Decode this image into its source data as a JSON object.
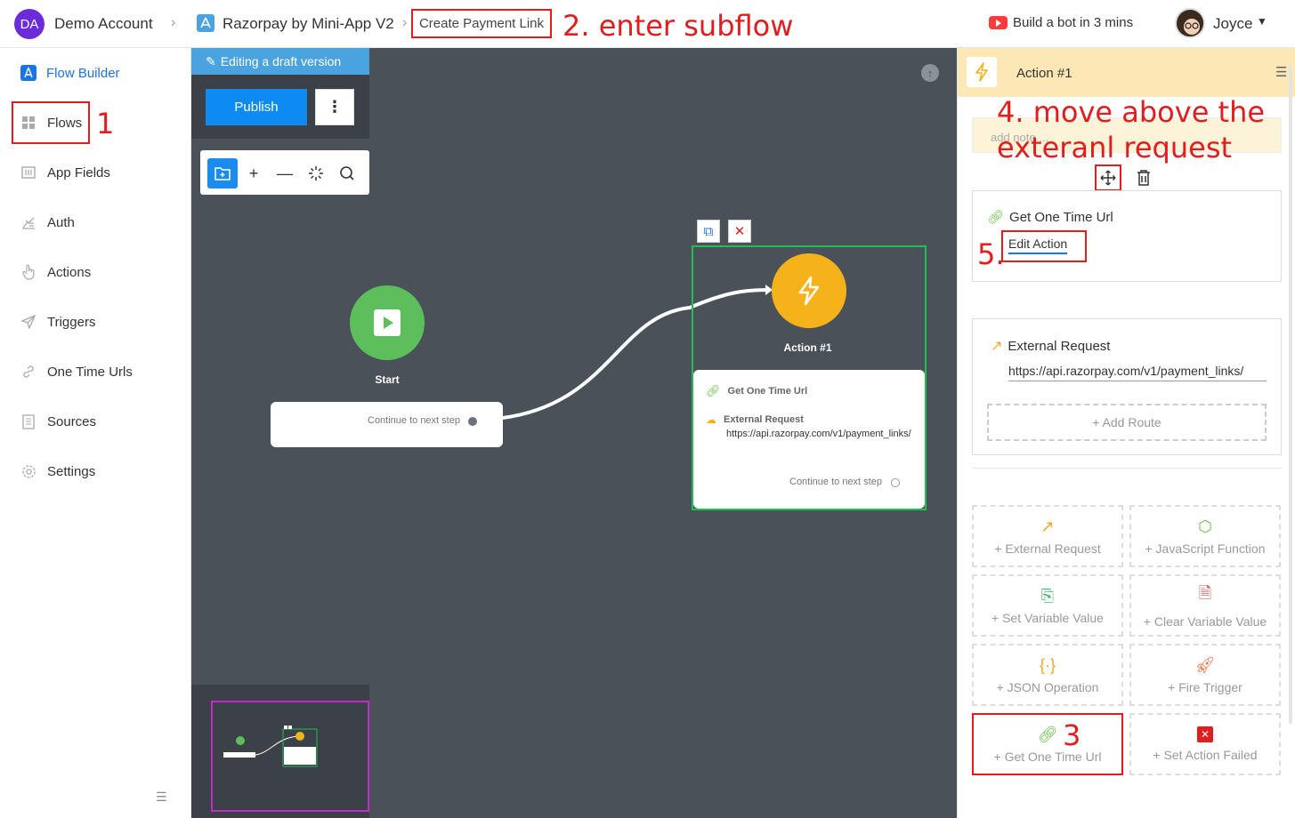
{
  "header": {
    "account_initials": "DA",
    "account_name": "Demo Account",
    "app_name": "Razorpay by Mini-App V2",
    "breadcrumb_current": "Create Payment Link",
    "bot_link": "Build a bot in 3 mins",
    "user_name": "Joyce"
  },
  "sidebar": {
    "items": [
      {
        "label": "Flow Builder",
        "icon": "flow-builder-icon"
      },
      {
        "label": "Flows",
        "icon": "grid-icon"
      },
      {
        "label": "App Fields",
        "icon": "app-fields-icon"
      },
      {
        "label": "Auth",
        "icon": "auth-icon"
      },
      {
        "label": "Actions",
        "icon": "hand-pointer-icon"
      },
      {
        "label": "Triggers",
        "icon": "send-icon"
      },
      {
        "label": "One Time Urls",
        "icon": "link-icon"
      },
      {
        "label": "Sources",
        "icon": "document-icon"
      },
      {
        "label": "Settings",
        "icon": "gear-icon"
      }
    ]
  },
  "canvas": {
    "draft_banner": "Editing a draft version",
    "publish_label": "Publish",
    "start_label": "Start",
    "start_continue": "Continue to next step",
    "action_label": "Action #1",
    "action_step1": "Get One Time Url",
    "action_step2": "External Request",
    "action_step2_url": "https://api.razorpay.com/v1/payment_links/",
    "action_continue": "Continue to next step"
  },
  "panel": {
    "title": "Action #1",
    "note_placeholder": "add note ...",
    "card1_title": "Get One Time Url",
    "card1_edit": "Edit Action",
    "card2_title": "External Request",
    "card2_url": "https://api.razorpay.com/v1/payment_links/",
    "add_route": "+ Add Route",
    "ops": [
      {
        "label": "+ External Request",
        "icon": "external-link-icon",
        "color": "#f5a623"
      },
      {
        "label": "+ JavaScript Function",
        "icon": "nodejs-icon",
        "color": "#6cc24a"
      },
      {
        "label": "+ Set Variable Value",
        "icon": "set-variable-icon",
        "color": "#3fb86b"
      },
      {
        "label": "+ Clear Variable Value",
        "icon": "clear-variable-icon",
        "color": "#e2453c"
      },
      {
        "label": "+ JSON Operation",
        "icon": "json-braces-icon",
        "color": "#f5a623"
      },
      {
        "label": "+ Fire Trigger",
        "icon": "rocket-icon",
        "color": "#f26b3a"
      },
      {
        "label": "+ Get One Time Url",
        "icon": "link-icon",
        "color": "#6cc24a"
      },
      {
        "label": "+ Set Action Failed",
        "icon": "close-box-icon",
        "color": "#e21d1d"
      }
    ]
  },
  "annotations": {
    "a1": "1",
    "a2": "2. enter subflow",
    "a3": "3",
    "a4_line1": "4. move above the",
    "a4_line2": "exteranl request",
    "a5": "5."
  }
}
